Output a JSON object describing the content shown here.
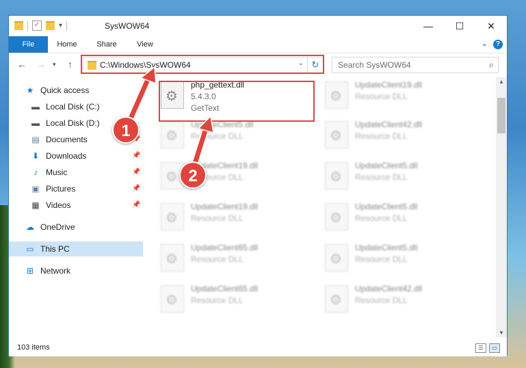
{
  "window": {
    "title": "SysWOW64",
    "controls": {
      "minimize": "—",
      "maximize": "☐",
      "close": "✕"
    }
  },
  "ribbon": {
    "tabs": [
      "File",
      "Home",
      "Share",
      "View"
    ],
    "help": "?"
  },
  "address_bar": {
    "path": "C:\\Windows\\SysWOW64",
    "search_placeholder": "Search SysWOW64"
  },
  "sidebar": {
    "quick_access": "Quick access",
    "items": [
      {
        "label": "Local Disk (C:)",
        "icon": "drive-icon",
        "pinned": true
      },
      {
        "label": "Local Disk (D:)",
        "icon": "drive-icon",
        "pinned": false
      },
      {
        "label": "Documents",
        "icon": "documents-icon",
        "pinned": true
      },
      {
        "label": "Downloads",
        "icon": "download-icon",
        "pinned": true
      },
      {
        "label": "Music",
        "icon": "music-icon",
        "pinned": true
      },
      {
        "label": "Pictures",
        "icon": "pictures-icon",
        "pinned": true
      },
      {
        "label": "Videos",
        "icon": "videos-icon",
        "pinned": true
      }
    ],
    "onedrive": "OneDrive",
    "this_pc": "This PC",
    "network": "Network"
  },
  "files": {
    "highlighted": {
      "name": "php_gettext.dll",
      "version": "5.4.3.0",
      "description": "GetText"
    },
    "background": [
      {
        "name": "UpdateClient19.dll",
        "type": "Resource DLL"
      },
      {
        "name": "UpdateClient5.dll",
        "type": "Resource DLL"
      },
      {
        "name": "UpdateClient42.dll",
        "type": "Resource DLL"
      },
      {
        "name": "UpdateClient19.dll",
        "type": "Resource DLL"
      },
      {
        "name": "UpdateClient5.dll",
        "type": "Resource DLL"
      },
      {
        "name": "UpdateClient19.dll",
        "type": "Resource DLL"
      },
      {
        "name": "UpdateClient5.dll",
        "type": "Resource DLL"
      },
      {
        "name": "UpdateClient65.dll",
        "type": "Resource DLL"
      },
      {
        "name": "UpdateClient5.dll",
        "type": "Resource DLL"
      },
      {
        "name": "UpdateClient65.dll",
        "type": "Resource DLL"
      },
      {
        "name": "UpdateClient42.dll",
        "type": "Resource DLL"
      }
    ]
  },
  "status": {
    "item_count": "103 items"
  },
  "annotations": {
    "step1": "1",
    "step2": "2"
  },
  "colors": {
    "accent": "#1979ca",
    "highlight": "#e0443c",
    "selection": "#cce4f7"
  }
}
